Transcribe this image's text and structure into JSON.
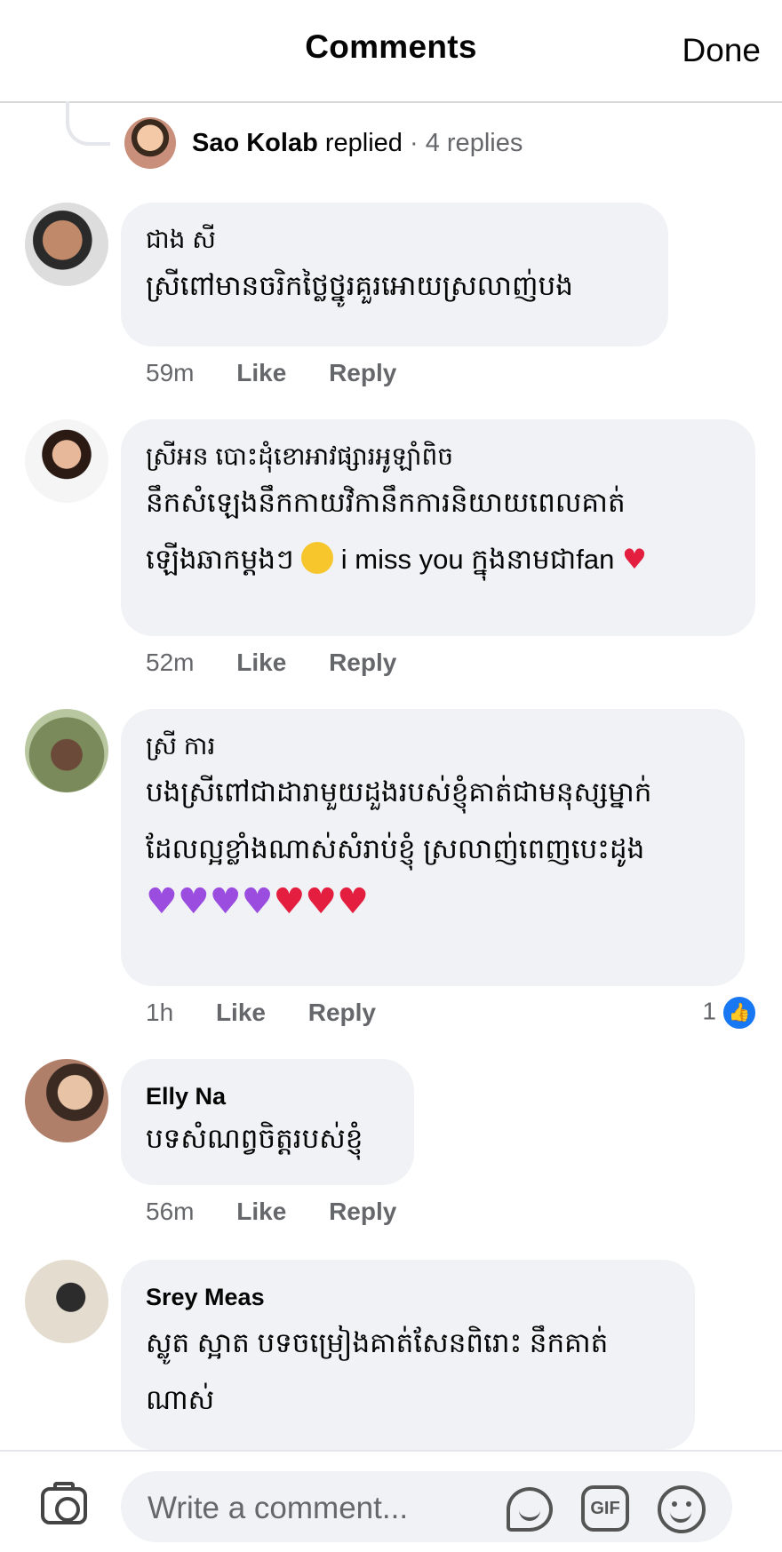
{
  "header": {
    "title": "Comments",
    "done_label": "Done"
  },
  "replied_summary": {
    "name": "Sao Kolab",
    "action": "replied",
    "separator": " · ",
    "replies": "4 replies"
  },
  "comments": [
    {
      "author": "ជាង សី",
      "lines": [
        "ស្រីពៅមានចរិកថ្លៃថ្នូរគួរអោយស្រលាញ់បង"
      ],
      "time": "59m",
      "like_label": "Like",
      "reply_label": "Reply"
    },
    {
      "author": "ស្រីអន បោះដុំខោអាវផ្សារអូឡាំពិច",
      "lines": [
        "នឹកសំឡេងនឹកកាយវិកានឹកការនិយាយពេលគាត់",
        "ឡើងឆាកម្តងៗ",
        "i miss you ក្នុងនាមជាfan"
      ],
      "time": "52m",
      "like_label": "Like",
      "reply_label": "Reply"
    },
    {
      "author": "ស្រី ការ",
      "lines": [
        "បងស្រីពៅជាដារាមួយដួងរបស់ខ្ញុំគាត់ជាមនុស្សម្នាក់",
        "ដែលល្អខ្លាំងណាស់សំរាប់ខ្ញុំ ស្រលាញ់ពេញបេះដូង"
      ],
      "emoji_line": "💜💜💜💜❤️❤️❤️",
      "time": "1h",
      "like_label": "Like",
      "reply_label": "Reply",
      "reaction_count": "1"
    },
    {
      "author": "Elly Na",
      "lines": [
        "បទសំណព្វចិត្តរបស់ខ្ញុំ"
      ],
      "time": "56m",
      "like_label": "Like",
      "reply_label": "Reply"
    },
    {
      "author": "Srey Meas",
      "lines": [
        "ស្លូត ស្អាត បទចម្រៀងគាត់សែនពិរោះ នឹកគាត់",
        "ណាស់"
      ]
    }
  ],
  "composer": {
    "placeholder": "Write a comment...",
    "gif_label": "GIF"
  },
  "colors": {
    "accent": "#1877f2",
    "bubble": "#f0f2f5",
    "muted": "#65676b"
  },
  "icons": [
    "camera-icon",
    "sticker-icon",
    "gif-icon",
    "smile-icon",
    "like-icon"
  ]
}
